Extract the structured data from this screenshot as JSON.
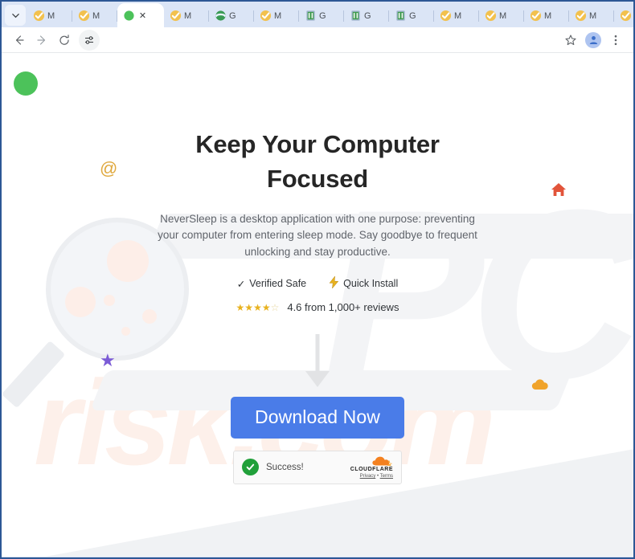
{
  "browser": {
    "tab_search_icon": "chevron-down-icon",
    "new_tab_label": "+",
    "tabs": [
      {
        "title": "M",
        "favicon": "gmail-check-icon",
        "active": false
      },
      {
        "title": "M",
        "favicon": "gmail-check-icon",
        "active": false
      },
      {
        "title": "",
        "favicon": "green-dot-icon",
        "active": true
      },
      {
        "title": "M",
        "favicon": "gmail-check-icon",
        "active": false
      },
      {
        "title": "G",
        "favicon": "globe-icon",
        "active": false
      },
      {
        "title": "M",
        "favicon": "gmail-check-icon",
        "active": false
      },
      {
        "title": "G",
        "favicon": "green-doc-icon",
        "active": false
      },
      {
        "title": "G",
        "favicon": "green-doc-icon",
        "active": false
      },
      {
        "title": "G",
        "favicon": "green-doc-icon",
        "active": false
      },
      {
        "title": "M",
        "favicon": "gmail-check-icon",
        "active": false
      },
      {
        "title": "M",
        "favicon": "gmail-check-icon",
        "active": false
      },
      {
        "title": "M",
        "favicon": "gmail-check-icon",
        "active": false
      },
      {
        "title": "M",
        "favicon": "gmail-check-icon",
        "active": false
      },
      {
        "title": "M",
        "favicon": "gmail-check-icon",
        "active": false
      },
      {
        "title": "M",
        "favicon": "gmail-check-icon",
        "active": false
      }
    ],
    "window_controls": {
      "minimize": "minimize-icon",
      "maximize": "maximize-icon",
      "close": "close-icon"
    },
    "toolbar": {
      "back": "back-arrow-icon",
      "forward": "forward-arrow-icon",
      "reload": "reload-icon",
      "tune": "tune-icon",
      "bookmark": "star-icon",
      "profile": "profile-avatar-icon",
      "menu": "three-dot-menu-icon"
    }
  },
  "page": {
    "headline": "Keep Your Computer Focused",
    "subtext": "NeverSleep is a desktop application with one purpose: preventing your computer from entering sleep mode. Say goodbye to frequent unlocking and stay productive.",
    "badges": [
      {
        "icon": "check-mark-icon",
        "glyph": "✓",
        "label": "Verified Safe"
      },
      {
        "icon": "lightning-bolt-icon",
        "glyph": "⚡",
        "label": "Quick Install"
      }
    ],
    "rating": {
      "stars_filled": 4,
      "stars_empty": 1,
      "text": "4.6 from 1,000+ reviews"
    },
    "download_button": "Download Now",
    "turnstile": {
      "status": "Success!",
      "brand": "CLOUDFLARE",
      "privacy": "Privacy",
      "separator": "•",
      "terms": "Terms"
    },
    "watermarks": {
      "pc": "PC",
      "risk": "risk.com"
    },
    "decorations": [
      {
        "name": "green-circle-icon",
        "glyph": ""
      },
      {
        "name": "at-symbol-icon",
        "glyph": "@"
      },
      {
        "name": "purple-star-icon",
        "glyph": "★"
      },
      {
        "name": "house-icon",
        "glyph": "⌂"
      },
      {
        "name": "cloud-icon",
        "glyph": "☁"
      }
    ]
  },
  "colors": {
    "accent_blue": "#4a7ce8",
    "frame_blue": "#2d5795",
    "tab_bg": "#dbe5f6",
    "green": "#4cc25a",
    "gold": "#e8b21f",
    "cloudflare_orange": "#f48120"
  }
}
